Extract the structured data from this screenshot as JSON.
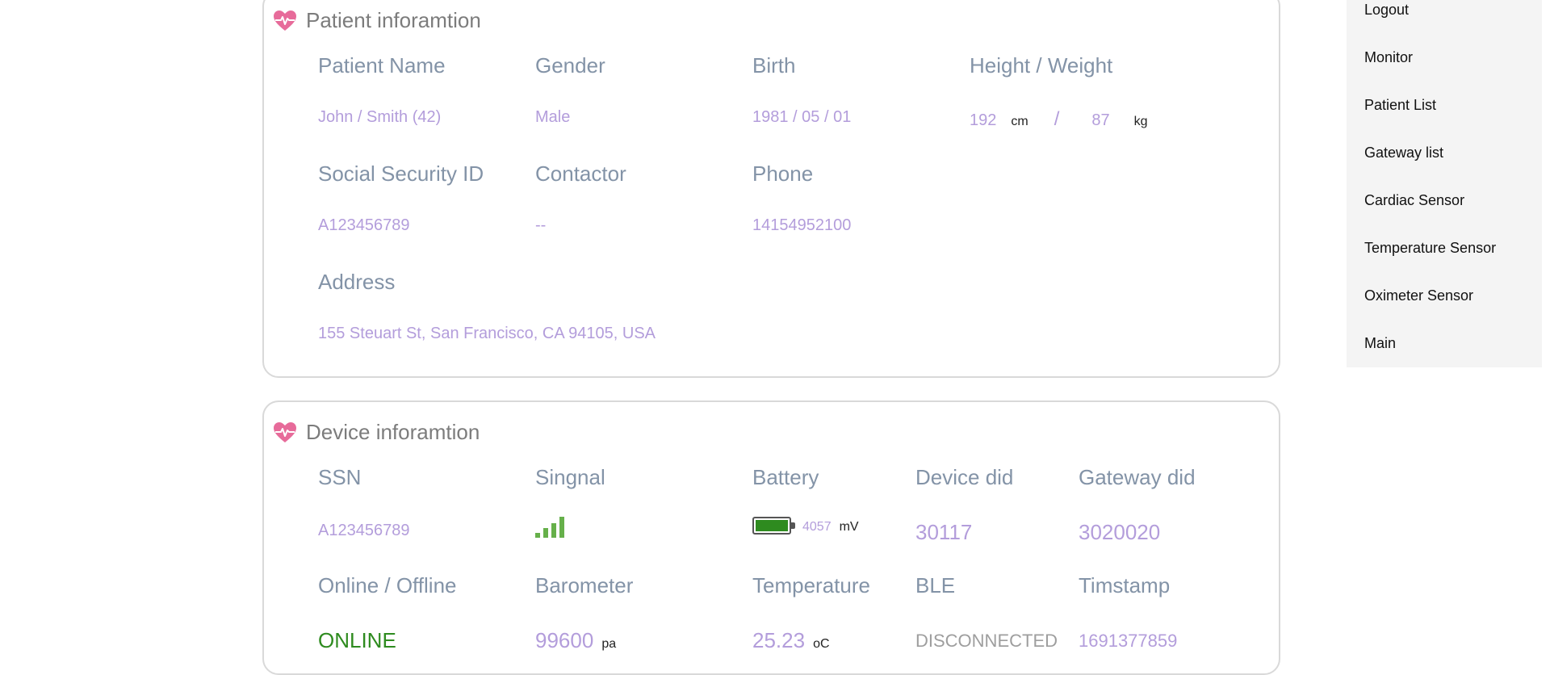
{
  "patient": {
    "title": "Patient inforamtion",
    "labels": {
      "name": "Patient Name",
      "gender": "Gender",
      "birth": "Birth",
      "height_weight": "Height / Weight",
      "ssid": "Social Security ID",
      "contactor": "Contactor",
      "phone": "Phone",
      "address": "Address"
    },
    "values": {
      "name": "John / Smith (42)",
      "gender": "Male",
      "birth": "1981 / 05 / 01",
      "height": "192",
      "height_unit": "cm",
      "separator": "/",
      "weight": "87",
      "weight_unit": "kg",
      "ssid": "A123456789",
      "contactor": "--",
      "phone": "14154952100",
      "address": "155 Steuart St, San Francisco, CA 94105, USA"
    }
  },
  "device": {
    "title": "Device inforamtion",
    "labels": {
      "ssn": "SSN",
      "signal": "Singnal",
      "battery": "Battery",
      "device_did": "Device did",
      "gateway_did": "Gateway did",
      "online": "Online / Offline",
      "barometer": "Barometer",
      "temperature": "Temperature",
      "ble": "BLE",
      "timestamp": "Timstamp"
    },
    "values": {
      "ssn": "A123456789",
      "signal_level": 4,
      "battery_level": 1.0,
      "battery_mv": "4057",
      "battery_unit": "mV",
      "device_did": "30117",
      "gateway_did": "3020020",
      "online": "ONLINE",
      "barometer": "99600",
      "barometer_unit": "pa",
      "temperature": "25.23",
      "temperature_unit": "oC",
      "ble": "DISCONNECTED",
      "timestamp": "1691377859"
    }
  },
  "menu": {
    "items": [
      "Logout",
      "Monitor",
      "Patient List",
      "Gateway list",
      "Cardiac Sensor",
      "Temperature Sensor",
      "Oximeter Sensor",
      "Main"
    ]
  },
  "colors": {
    "label": "#8393a7",
    "value": "#b39ddb",
    "online": "#2e8b1f",
    "signal": "#66b04a",
    "heart": "#e76b9a"
  }
}
